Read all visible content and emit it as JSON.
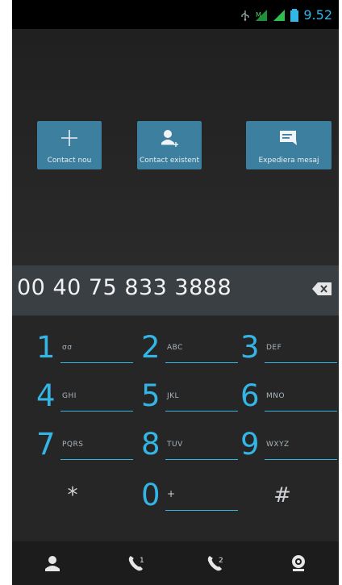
{
  "status": {
    "time": "9.52"
  },
  "actions": [
    {
      "label": "Contact nou"
    },
    {
      "label": "Contact existent"
    },
    {
      "label": "Expediera mesaj"
    }
  ],
  "dial": {
    "number": "00 40 75 833 3888"
  },
  "keys": [
    {
      "digit": "1",
      "sub": "σσ"
    },
    {
      "digit": "2",
      "sub": "ABC"
    },
    {
      "digit": "3",
      "sub": "DEF"
    },
    {
      "digit": "4",
      "sub": "GHI"
    },
    {
      "digit": "5",
      "sub": "JKL"
    },
    {
      "digit": "6",
      "sub": "MNO"
    },
    {
      "digit": "7",
      "sub": "PQRS"
    },
    {
      "digit": "8",
      "sub": "TUV"
    },
    {
      "digit": "9",
      "sub": "WXYZ"
    },
    {
      "digit": "*",
      "sub": ""
    },
    {
      "digit": "0",
      "sub": "+"
    },
    {
      "digit": "#",
      "sub": ""
    }
  ],
  "bottom": {
    "sim1_badge": "1",
    "sim2_badge": "2"
  },
  "colors": {
    "accent": "#33b5e5",
    "action_bg": "#3d7f9f"
  }
}
